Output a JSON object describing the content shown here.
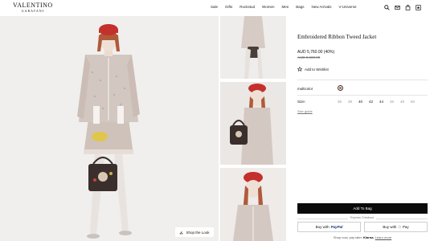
{
  "brand": {
    "name": "VALENTINO",
    "sub": "GARAVANI"
  },
  "nav": [
    "Sale",
    "Gifts",
    "Rockstud",
    "Women",
    "Men",
    "Bags",
    "New Arrivals",
    "V-Universe"
  ],
  "header_icons": [
    "search-icon",
    "account-icon",
    "bag-icon",
    "wishlist-icon"
  ],
  "main": {
    "shop_the_look": "Shop the Look"
  },
  "product": {
    "title": "Embroidered Ribbon Tweed Jacket",
    "price": "AUD 5,760.00 (40%)",
    "old_price": "AUD 9,600.00",
    "wishlist_label": "Add to Wishlist",
    "color_label": "multicolor",
    "size_label": "Size:",
    "sizes": [
      "36",
      "38",
      "40",
      "42",
      "44",
      "46",
      "48",
      "50"
    ],
    "available_sizes": [
      "40",
      "42",
      "44"
    ],
    "size_guide": "Size guide",
    "add_to_bag": "Add To Bag",
    "express_checkout": "Express Checkout",
    "pay_paypal_prefix": "Buy with",
    "pay_paypal_brand": "PayPal",
    "pay_apple_prefix": "Buy with",
    "pay_apple_brand": "Pay",
    "klarna_text": "Shop now, pay later.",
    "klarna_brand": "Klarna.",
    "klarna_link": "Learn more"
  },
  "colors": {
    "accent": "#0a0a0a",
    "hat_red": "#c4302b",
    "tweed": "#cdbfb6"
  }
}
